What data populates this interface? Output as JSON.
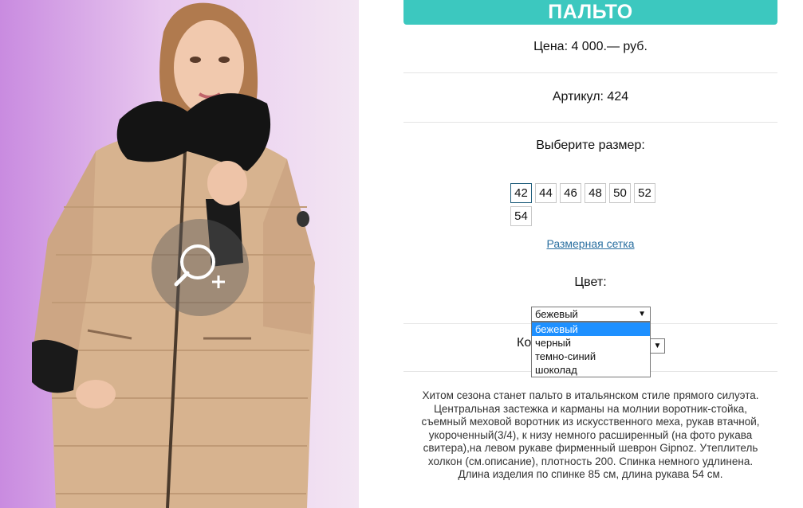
{
  "product": {
    "title": "ПАЛЬТО",
    "price": "Цена: 4 000.— руб.",
    "sku": "Артикул: 424",
    "size_label": "Выберите размер:",
    "sizes": [
      "42",
      "44",
      "46",
      "48",
      "50",
      "52",
      "54"
    ],
    "selected_size": "42",
    "size_chart_link": "Размерная сетка",
    "color_label": "Цвет:",
    "color_selected": "бежевый",
    "color_options": [
      "бежевый",
      "черный",
      "темно-синий",
      "шоколад"
    ],
    "qty_label_visible": "Ко",
    "description": "Хитом сезона станет пальто в итальянском стиле прямого силуэта. Центральная застежка и карманы на молнии воротник-стойка, съемный меховой воротник из искусственного меха, рукав втачной, укороченный(3/4), к низу немного расширенный (на фото рукава свитера),на левом рукаве фирменный шеврон Gipnoz. Утеплитель холкон (см.описание), плотность 200. Спинка немного удлинена. Длина изделия по спинке 85 см, длина рукава 54 см."
  },
  "icons": {
    "zoom": "zoom-plus-icon",
    "dropdown_arrow": "triangle-down-icon"
  },
  "colors": {
    "accent": "#3cc8bf",
    "link": "#2a6fa0",
    "selected_option": "#1e90ff"
  }
}
